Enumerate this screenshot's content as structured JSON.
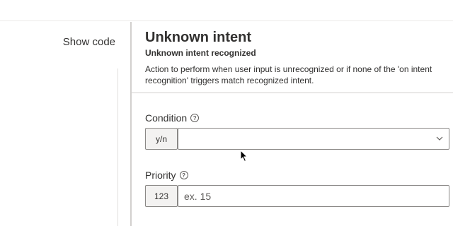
{
  "left": {
    "show_code_label": "Show code"
  },
  "panel": {
    "title": "Unknown intent",
    "subtitle": "Unknown intent recognized",
    "description": "Action to perform when user input is unrecognized or if none of the 'on intent recognition' triggers match recognized intent."
  },
  "fields": {
    "condition": {
      "label": "Condition",
      "type_chip": "y/n",
      "value": ""
    },
    "priority": {
      "label": "Priority",
      "type_chip": "123",
      "placeholder": "ex. 15"
    }
  }
}
